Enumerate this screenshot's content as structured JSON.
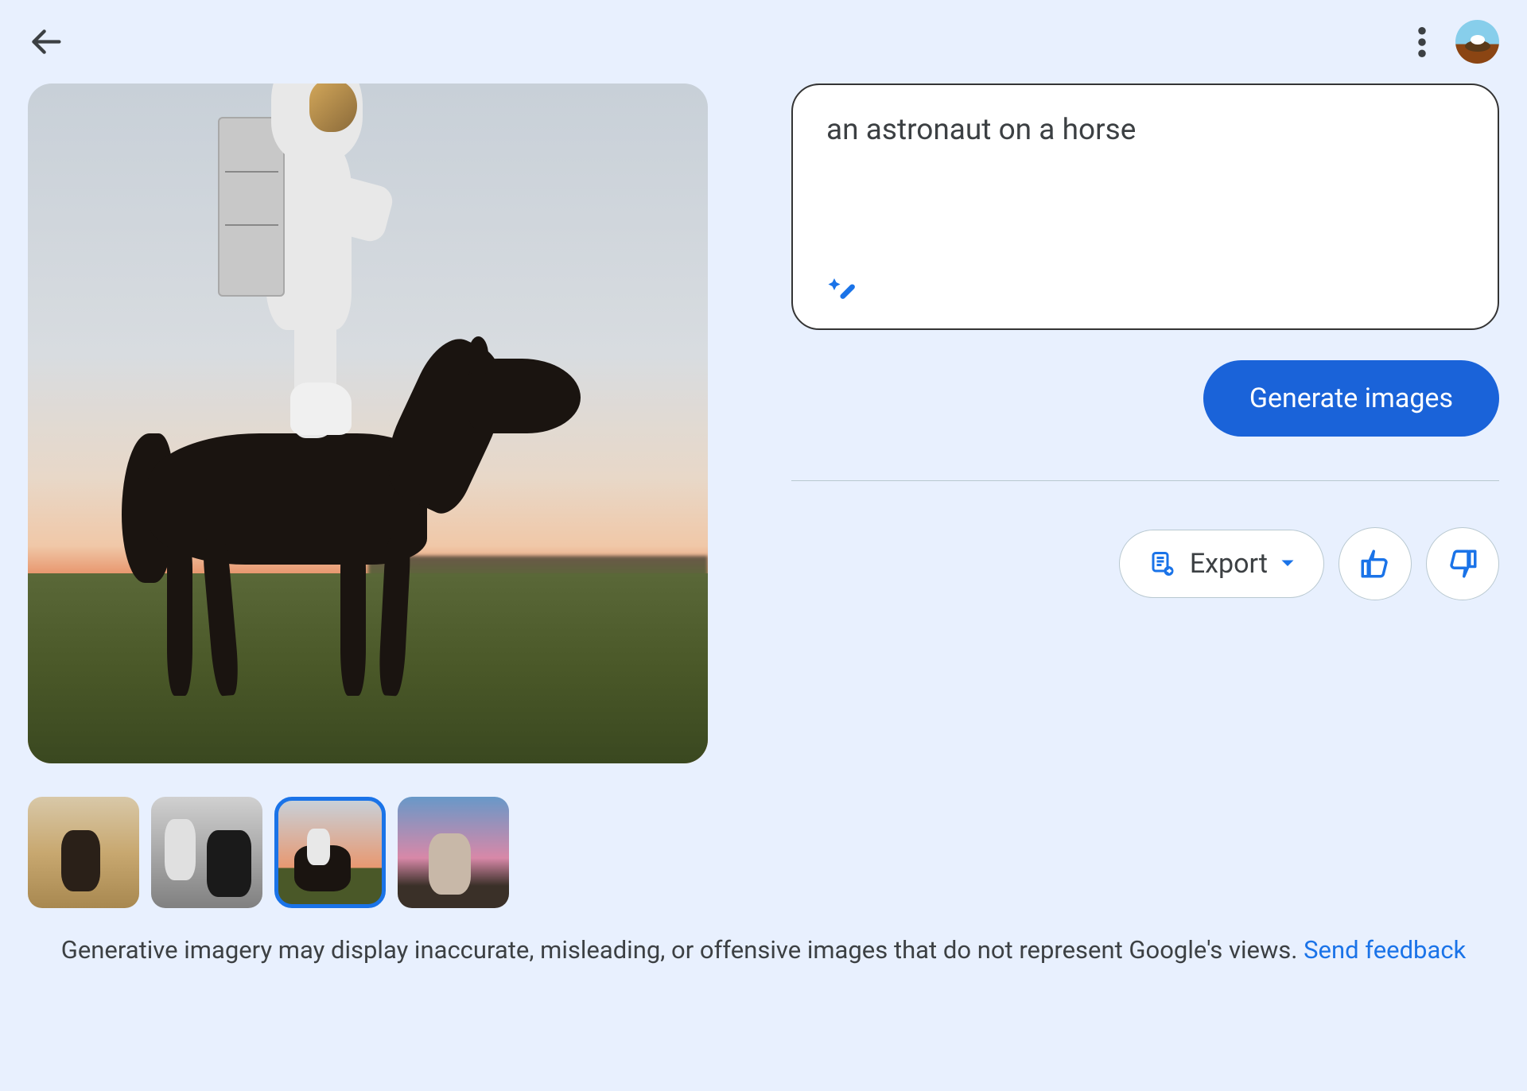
{
  "prompt": {
    "text": "an astronaut on a horse"
  },
  "buttons": {
    "generate": "Generate images",
    "export": "Export"
  },
  "thumbnails": {
    "selected_index": 2
  },
  "disclaimer": {
    "text": "Generative imagery may display inaccurate, misleading, or offensive images that do not represent Google's views. ",
    "link_text": "Send feedback"
  }
}
